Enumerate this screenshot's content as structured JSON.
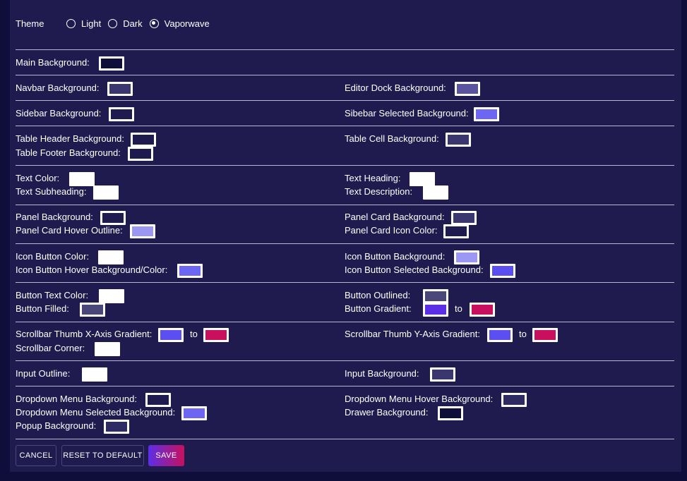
{
  "theme": {
    "label": "Theme",
    "options": [
      "Light",
      "Dark",
      "Vaporwave"
    ],
    "selected": "Vaporwave"
  },
  "fields": {
    "main_bg": {
      "label": "Main Background:",
      "color": "#0f0d3a"
    },
    "navbar_bg": {
      "label": "Navbar Background:",
      "color": "#3a366e"
    },
    "editor_dock_bg": {
      "label": "Editor Dock Background:",
      "color": "#5a54a0"
    },
    "sidebar_bg": {
      "label": "Sidebar Background:",
      "color": "#1f1b4e"
    },
    "sidebar_selected_bg": {
      "label": "Sibebar Selected Background:",
      "color": "#6d66f2"
    },
    "table_header_bg": {
      "label": "Table Header Background:",
      "color": "#1f1b4e"
    },
    "table_cell_bg": {
      "label": "Table Cell Background:",
      "color": "#3a366e"
    },
    "table_footer_bg": {
      "label": "Table Footer Background:",
      "color": "#1f1b4e"
    },
    "text_color": {
      "label": "Text Color:",
      "color": "#ffffff"
    },
    "text_heading": {
      "label": "Text Heading:",
      "color": "#ffffff"
    },
    "text_subheading": {
      "label": "Text Subheading:",
      "color": "#ffffff"
    },
    "text_description": {
      "label": "Text Description:",
      "color": "#ffffff"
    },
    "panel_bg": {
      "label": "Panel Background:",
      "color": "#1f1b4e"
    },
    "panel_card_bg": {
      "label": "Panel Card Background:",
      "color": "#3a366e"
    },
    "panel_card_hover_outline": {
      "label": "Panel Card Hover Outline:",
      "color": "#9c97f2"
    },
    "panel_card_icon_color": {
      "label": "Panel Card Icon Color:",
      "color": "#1f1b4e"
    },
    "icon_button_color": {
      "label": "Icon Button Color:",
      "color": "#ffffff"
    },
    "icon_button_bg": {
      "label": "Icon Button Background:",
      "color": "#9c97f2"
    },
    "icon_button_hover": {
      "label": "Icon Button Hover Background/Color:",
      "color": "#6d66f2"
    },
    "icon_button_selected_bg": {
      "label": "Icon Button Selected Background:",
      "color": "#5b4ff2"
    },
    "button_text_color": {
      "label": "Button Text Color:",
      "color": "#ffffff"
    },
    "button_outlined": {
      "label": "Button Outlined:",
      "color": "#4a4779"
    },
    "button_filled": {
      "label": "Button Filled:",
      "color": "#4a4779"
    },
    "button_gradient": {
      "label": "Button Gradient:",
      "color_from": "#5b2fe6",
      "color_to": "#c8105e",
      "to": "to"
    },
    "scrollbar_x": {
      "label": "Scrollbar Thumb X-Axis Gradient:",
      "color_from": "#5b4ff2",
      "color_to": "#c8105e",
      "to": "to"
    },
    "scrollbar_y": {
      "label": "Scrollbar Thumb Y-Axis Gradient:",
      "color_from": "#5b4ff2",
      "color_to": "#c8105e",
      "to": "to"
    },
    "scrollbar_corner": {
      "label": "Scrollbar Corner:",
      "color": "#ffffff"
    },
    "input_outline": {
      "label": "Input Outline:",
      "color": "#ffffff"
    },
    "input_bg": {
      "label": "Input Background:",
      "color": "#3a366e"
    },
    "dropdown_bg": {
      "label": "Dropdown Menu Background:",
      "color": "#1f1b4e"
    },
    "dropdown_hover_bg": {
      "label": "Dropdown Menu Hover Background:",
      "color": "#2e2a62"
    },
    "dropdown_selected_bg": {
      "label": "Dropdown Menu Selected Background:",
      "color": "#6d66f2"
    },
    "drawer_bg": {
      "label": "Drawer Background:",
      "color": "#0f0d3a"
    },
    "popup_bg": {
      "label": "Popup Background:",
      "color": "#2e2a62"
    }
  },
  "actions": {
    "cancel": "CANCEL",
    "reset": "RESET TO DEFAULT",
    "save": "SAVE"
  }
}
